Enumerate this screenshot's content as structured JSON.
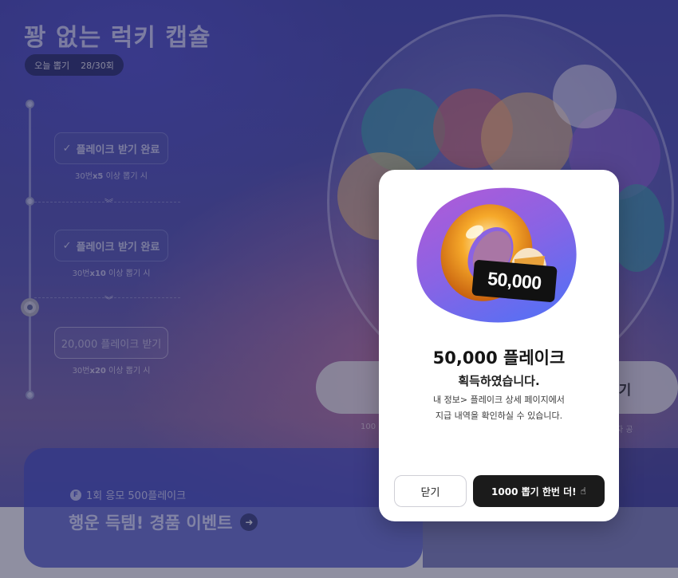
{
  "page": {
    "title": "꽝 없는 럭키 캡슐",
    "today_label": "오늘 뽑기",
    "today_count": "28/30회"
  },
  "rewards": [
    {
      "label": "플레이크 받기 완료",
      "condition_pre": "30번",
      "multiplier": "x5",
      "condition_post": " 이상 뽑기 시",
      "done": true
    },
    {
      "label": "플레이크 받기 완료",
      "condition_pre": "30번",
      "multiplier": "x10",
      "condition_post": " 이상 뽑기 시",
      "done": true
    },
    {
      "label": "20,000 플레이크 받기",
      "condition_pre": "30번",
      "multiplier": "x20",
      "condition_post": " 이상 뽑기 시",
      "done": false
    }
  ],
  "background": {
    "draw_button_right_label": "뽑기",
    "small_left": "100",
    "small_right": "자 공"
  },
  "event": {
    "sub": "1회 응모 500플레이크",
    "coin_icon_text": "F",
    "title": "행운 득템! 경품 이벤트"
  },
  "modal": {
    "badge_amount": "50,000",
    "title": "50,000 플레이크",
    "subtitle": "획득하였습니다.",
    "desc_line1": "내 정보> 플레이크 상세 페이지에서",
    "desc_line2": "지급 내역을 확인하실 수 있습니다.",
    "close_label": "닫기",
    "again_label": "1000 뽑기 한번 더!",
    "hand_icon": "☝"
  },
  "colors": {
    "accent_dark": "#1b1b1b",
    "blob_top": "#a35bd8",
    "blob_bottom": "#5b6ef0",
    "page_bg": "#3a3f9e"
  }
}
